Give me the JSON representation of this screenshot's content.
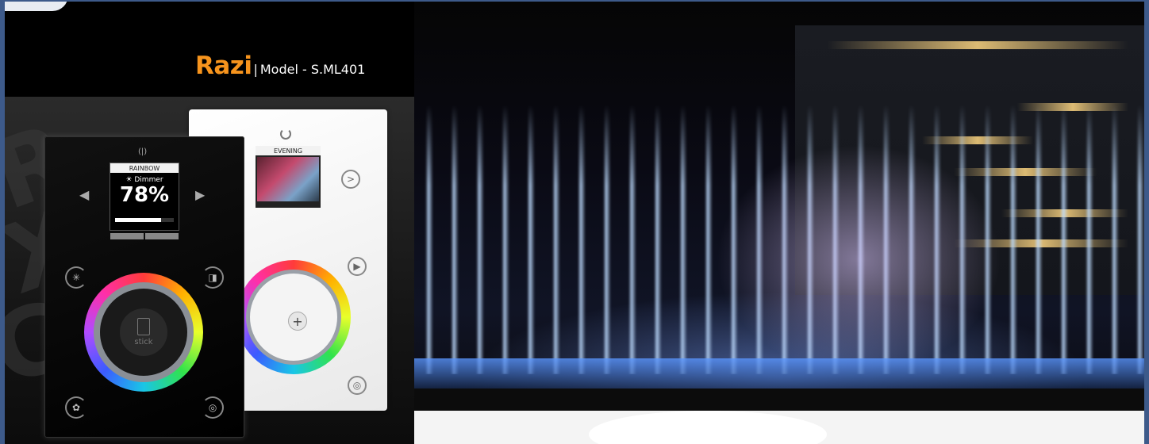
{
  "header": {
    "brand": "Razi",
    "model": "Model - S.ML401"
  },
  "white_controller": {
    "screen_title": "EVENING"
  },
  "black_controller": {
    "screen_title": "RAINBOW",
    "dimmer_label": "Dimmer",
    "dimmer_value": "78%",
    "dimmer_level": 0.78,
    "logo_text": "stick"
  },
  "colors": {
    "brand_orange": "#f7941d",
    "page_border": "#3d5a8a"
  }
}
